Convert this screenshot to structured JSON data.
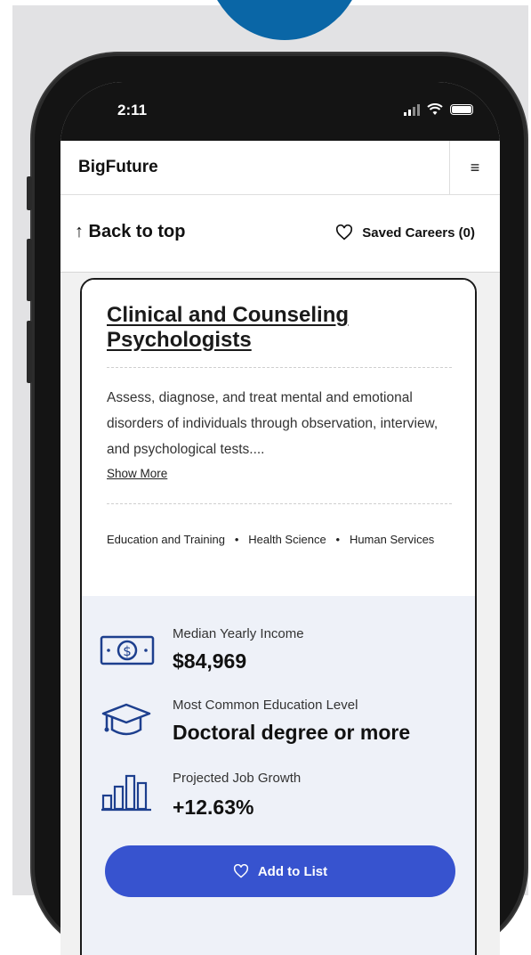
{
  "status_bar": {
    "time": "2:11"
  },
  "header": {
    "brand": "BigFuture",
    "menu_icon": "≡"
  },
  "subnav": {
    "back_label": "↑ Back to top",
    "saved_label": "Saved Careers (0)"
  },
  "career": {
    "title_line1": "Clinical and Counseling",
    "title_line2": "Psychologists",
    "description": "Assess, diagnose, and treat mental and emotional disorders of individuals through observation, interview, and psychological tests....",
    "show_more": "Show More",
    "clusters": [
      "Education and Training",
      "Health Science",
      "Human Services"
    ]
  },
  "stats": {
    "income_label": "Median Yearly Income",
    "income_value": "$84,969",
    "education_label": "Most Common Education Level",
    "education_value": "Doctoral degree or more",
    "growth_label": "Projected Job Growth",
    "growth_value": "+12.63%"
  },
  "actions": {
    "add_to_list": "Add to List"
  },
  "colors": {
    "accent_blue": "#3753cf",
    "decor_circle": "#0a66a6",
    "stats_bg": "#eef1f8"
  }
}
